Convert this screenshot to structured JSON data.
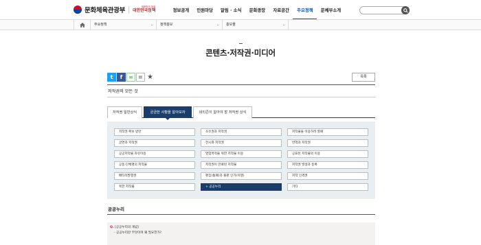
{
  "header": {
    "logo_text": "문화체육관광부",
    "logo_sub_small": "대한민국 대표",
    "logo_sub_main": "대한민국정책",
    "nav": [
      "정보공개",
      "민원마당",
      "알림 · 소식",
      "문화광장",
      "자료공간",
      "주요정책",
      "문체부소개"
    ],
    "active_nav_index": 5,
    "search_placeholder": ""
  },
  "location": {
    "home_icon": "home-icon",
    "items": [
      "주요정책",
      "정책홍보",
      "홍보물"
    ]
  },
  "page": {
    "title": "콘텐츠·저작권·미디어",
    "list_button": "목록",
    "section_label": "저작권의 모든 것",
    "share_icons": [
      "twitter-icon",
      "facebook-icon",
      "link-icon",
      "print-icon",
      "star-icon"
    ]
  },
  "tabs": [
    {
      "label": "저작권 일반상식"
    },
    {
      "label": "궁금한 사항을 알아보자"
    },
    {
      "label": "네티즌이 알아야 할 저작권 상식"
    }
  ],
  "active_tab_index": 1,
  "grid": [
    [
      "저작권 확보 방안",
      "소유권과 저작권",
      "저작물을 이용하려 할때"
    ],
    [
      "글연과 저작권",
      "전시와 저작권",
      "번역과 저작권"
    ],
    [
      "공공저작물 자유이용",
      "영업목적을 위한 저작물 이용",
      "공표된 저작물의 이용"
    ],
    [
      "공동·단체명의 저작물",
      "저작권이 만료된 저작물",
      "저작권 발생과 등록"
    ],
    [
      "배타적발행권",
      "편집(통폐)과 출판 인가(이행)",
      "저작 인격권"
    ],
    [
      "북한 저작물",
      "+ 공공누리",
      "기타"
    ]
  ],
  "selected_cell": [
    5,
    1
  ],
  "faq": {
    "heading": "공공누리",
    "q_mark": "Q.",
    "question": "[공공누리의 개념]",
    "sub": "- 공공누리란 무엇이며 왜 필요한가?"
  },
  "colors": {
    "navy": "#1a3d6b",
    "active_nav": "#0b55b5",
    "grid_bg": "#e9eef2"
  }
}
